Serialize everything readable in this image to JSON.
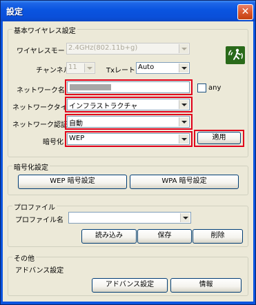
{
  "window": {
    "title": "設定",
    "close_glyph": "✕"
  },
  "basic": {
    "legend": "基本ワイヤレス設定",
    "wireless_mode": {
      "label": "ワイヤレスモード",
      "value": "2.4GHz(802.11b+g)"
    },
    "channel": {
      "label": "チャンネル",
      "value": "11"
    },
    "tx_rate": {
      "label": "Txレート",
      "value": "Auto"
    },
    "network_name": {
      "label": "ネットワーク名",
      "value": ""
    },
    "any": {
      "label": "any",
      "checked": false
    },
    "network_type": {
      "label": "ネットワークタイプ",
      "value": "インフラストラクチャ"
    },
    "network_auth": {
      "label": "ネットワーク認証",
      "value": "自動"
    },
    "encryption": {
      "label": "暗号化",
      "value": "WEP"
    },
    "apply_label": "適用",
    "icon": "wireless-signal-icon",
    "highlight_color": "#e0001b"
  },
  "encryption_settings": {
    "legend": "暗号化設定",
    "wep_button": "WEP 暗号設定",
    "wpa_button": "WPA 暗号設定"
  },
  "profile": {
    "legend": "プロファイル",
    "name_label": "プロファイル名",
    "name_value": "",
    "load_button": "読み込み",
    "save_button": "保存",
    "delete_button": "削除"
  },
  "other": {
    "legend": "その他",
    "advanced_label": "アドバンス設定",
    "advanced_button": "アドバンス設定",
    "info_button": "情報"
  }
}
